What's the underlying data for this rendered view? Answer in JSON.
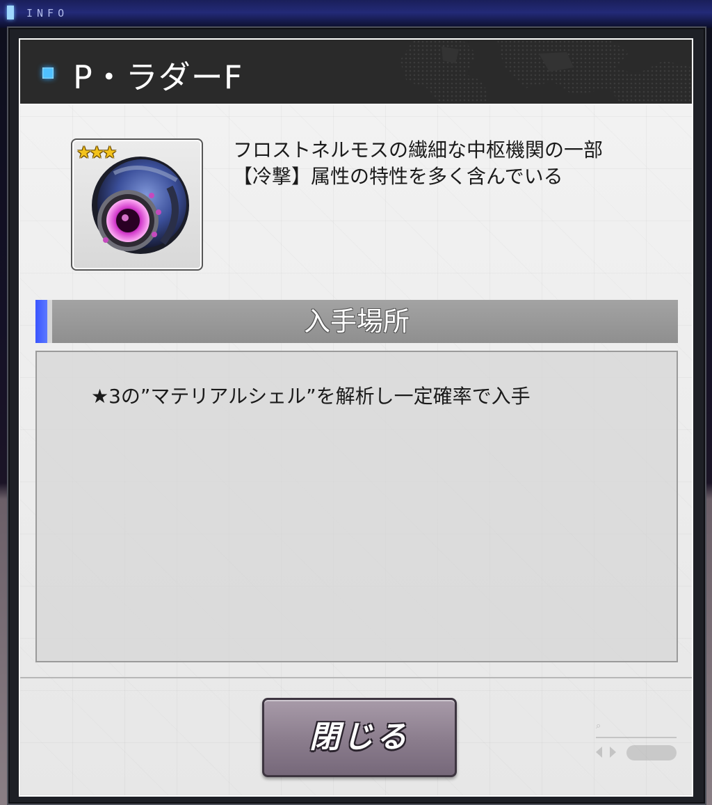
{
  "top_bar": {
    "label": "INFO",
    "accent_color": "#9fd8ff"
  },
  "dialog": {
    "title": "P・ラダーF",
    "title_bullet_color": "#4fc0ff",
    "item": {
      "rarity": 3,
      "stars": [
        "★",
        "★",
        "★"
      ],
      "icon": "mechanical-orb-icon"
    },
    "description": {
      "line1": "フロストネルモスの繊細な中枢機関の一部",
      "line2": "【冷撃】属性の特性を多く含んでいる"
    },
    "acquisition": {
      "header": "入手場所",
      "accent_color": "#3a55ff",
      "text": "★3の”マテリアルシェル”を解析し一定確率で入手"
    },
    "close_button_label": "閉じる"
  }
}
